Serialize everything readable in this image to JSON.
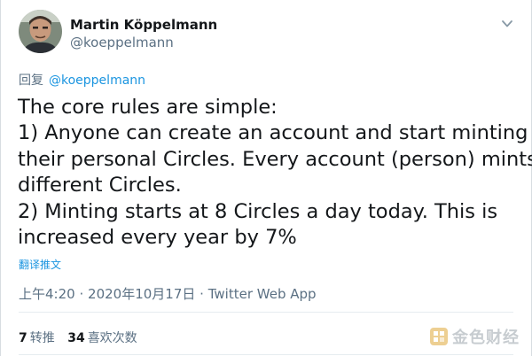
{
  "author": {
    "name": "Martin Köppelmann",
    "handle": "@koeppelmann"
  },
  "reply": {
    "label": "回复",
    "handle": "@koeppelmann"
  },
  "tweet": {
    "lines": [
      "The core rules are simple:",
      "1) Anyone can create an account and start minting",
      "their personal Circles. Every account (person) mints",
      "different Circles.",
      "2) Minting starts at 8 Circles a day today. This is",
      "increased every year by 7%"
    ]
  },
  "translate_label": "翻译推文",
  "meta": {
    "time": "上午4:20",
    "separator": "·",
    "date": "2020年10月17日",
    "source": "Twitter Web App"
  },
  "stats": {
    "retweets_count": "7",
    "retweets_label": "转推",
    "likes_count": "34",
    "likes_label": "喜欢次数"
  },
  "watermark": {
    "text": "金色财经"
  },
  "icons": {
    "menu": "chevron-down-icon",
    "watermark_logo": "golden-finance-logo-icon"
  },
  "colors": {
    "link": "#1b95e0",
    "secondary_text": "#5b7083",
    "primary_text": "#14171a"
  }
}
